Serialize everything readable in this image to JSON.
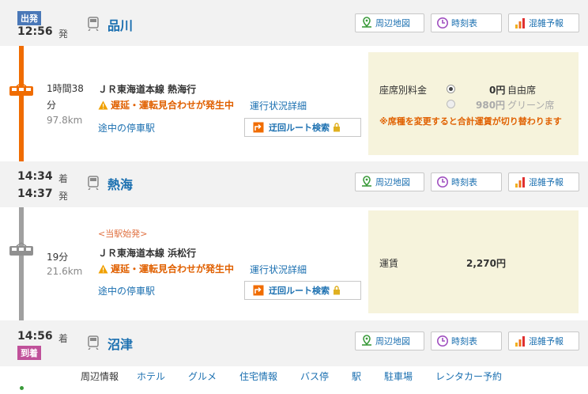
{
  "departure": {
    "badge": "出発",
    "time": "12:56",
    "suffix": "発",
    "station": "品川"
  },
  "buttons": {
    "map": "周辺地図",
    "timetable": "時刻表",
    "crowd": "混雑予報"
  },
  "segment1": {
    "duration_line1": "1時間38",
    "duration_line2": "分",
    "distance": "97.8km",
    "line_name": "ＪＲ東海道本線 熱海行",
    "delay": "遅延・運転見合わせが発生中",
    "status_link": "運行状況詳細",
    "stops_link": "途中の停車駅",
    "detour": "迂回ルート検索",
    "fare": {
      "label": "座席別料金",
      "option1_price": "0円",
      "option1_type": "自由席",
      "option2_price": "980円",
      "option2_type": "グリーン席",
      "note": "※席種を変更すると合計運賃が切り替わります"
    }
  },
  "transfer": {
    "arr_time": "14:34",
    "arr_suffix": "着",
    "dep_time": "14:37",
    "dep_suffix": "発",
    "station": "熱海"
  },
  "segment2": {
    "origin_note": "<当駅始発>",
    "duration": "19分",
    "distance": "21.6km",
    "line_name": "ＪＲ東海道本線 浜松行",
    "delay": "遅延・運転見合わせが発生中",
    "status_link": "運行状況詳細",
    "stops_link": "途中の停車駅",
    "detour": "迂回ルート検索",
    "fare": {
      "label": "運賃",
      "amount": "2,270円"
    }
  },
  "arrival": {
    "badge": "到着",
    "time": "14:56",
    "suffix": "着",
    "station": "沼津"
  },
  "nearby": {
    "label": "周辺情報",
    "links": [
      "ホテル",
      "グルメ",
      "住宅情報",
      "バス停",
      "駅",
      "駐車場",
      "レンタカー予約"
    ]
  },
  "colors": {
    "accent_blue": "#1a6fb0",
    "line_orange": "#f06c00",
    "line_gray": "#a0a0a0",
    "warning": "#e06000",
    "fare_bg": "#f6f3dc"
  }
}
